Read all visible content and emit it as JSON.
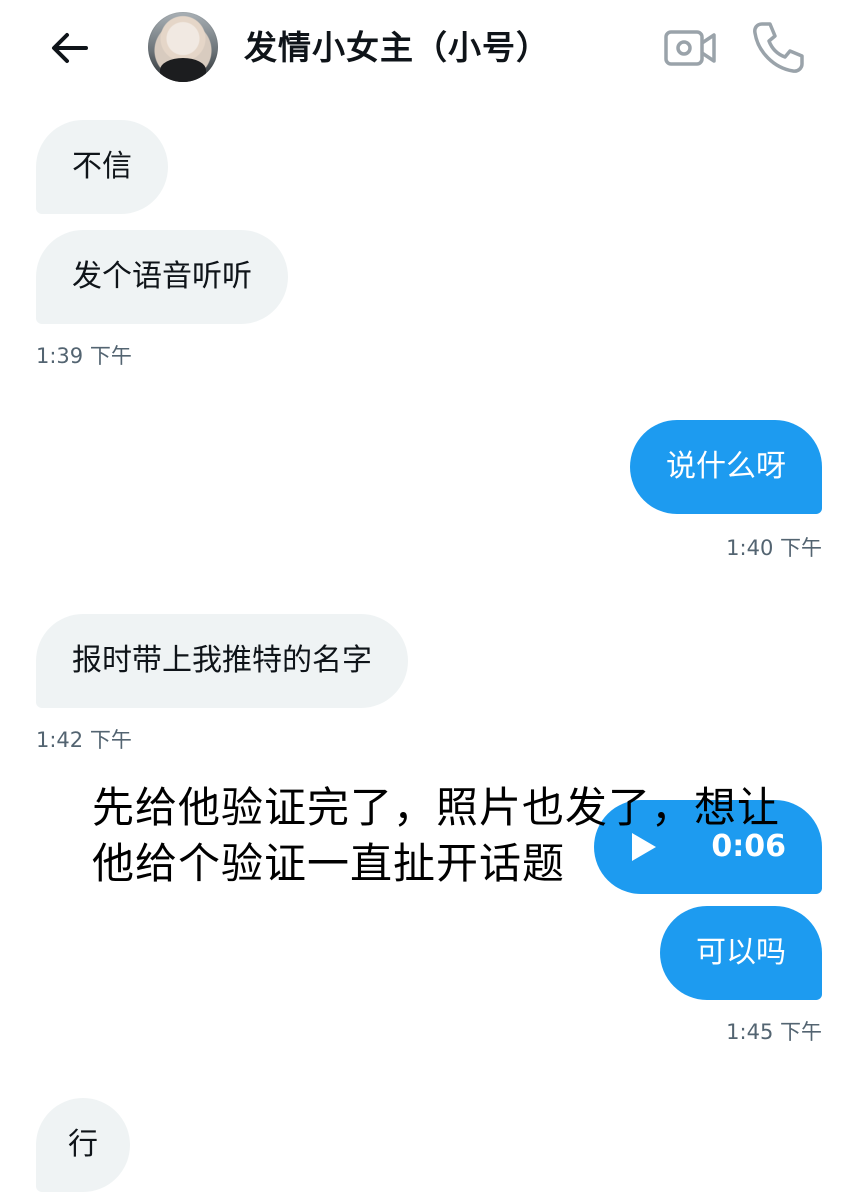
{
  "header": {
    "title": "发情小女主（小号）",
    "back_icon": "back-arrow-icon",
    "video_icon": "video-call-icon",
    "call_icon": "phone-icon"
  },
  "messages": [
    {
      "side": "incoming",
      "text": "不信"
    },
    {
      "side": "incoming",
      "text": "发个语音听听",
      "time": "1:39 下午"
    },
    {
      "side": "outgoing",
      "text": "说什么呀",
      "time": "1:40 下午"
    },
    {
      "side": "incoming",
      "text": "报时带上我推特的名字",
      "time": "1:42 下午"
    },
    {
      "side": "outgoing",
      "type": "voice",
      "duration": "0:06"
    },
    {
      "side": "outgoing",
      "text": "可以吗",
      "time": "1:45 下午"
    },
    {
      "side": "incoming",
      "text": "行"
    }
  ],
  "overlay_caption": {
    "line1": "先给他验证完了，照片也发了，想让",
    "line2": "他给个验证一直扯开话题"
  },
  "colors": {
    "outgoing_bubble": "#1d9bf0",
    "incoming_bubble": "#eff3f4",
    "timestamp": "#536471"
  }
}
